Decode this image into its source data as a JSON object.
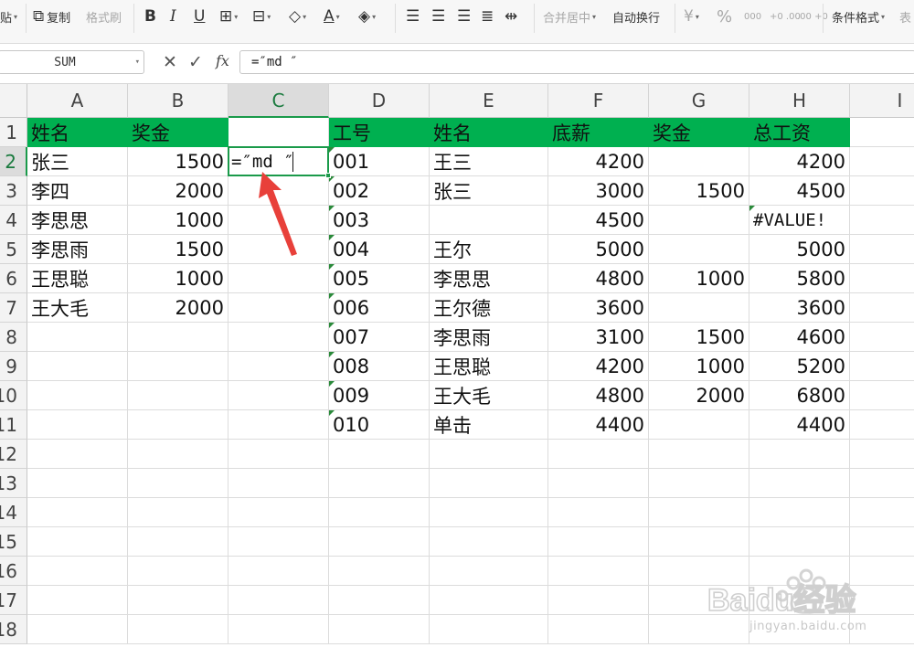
{
  "ribbon": {
    "paste_label": "贴",
    "copy_label": "复制",
    "format_painter_label": "格式刷",
    "bold_label": "B",
    "italic_label": "I",
    "underline_label": "U",
    "merge_center_label": "合并居中",
    "wrap_text_label": "自动换行",
    "percent_label": "%",
    "thousands_label": "000",
    "inc_decimal_label": "+0 .00",
    "dec_decimal_label": ".00 +0",
    "cond_format_label": "条件格式",
    "table_label": "表"
  },
  "formula_bar": {
    "name_box": "SUM",
    "fx_label": "fx",
    "formula": "=″md ″"
  },
  "columns": [
    "A",
    "B",
    "C",
    "D",
    "E",
    "F",
    "G",
    "H",
    "I"
  ],
  "rows": [
    "1",
    "2",
    "3",
    "4",
    "5",
    "6",
    "7",
    "8",
    "9",
    "10",
    "11",
    "12",
    "13",
    "14",
    "15",
    "16",
    "17",
    "18"
  ],
  "active_cell": {
    "ref": "C2",
    "text": "=″md ″"
  },
  "bonus_table": {
    "headers": [
      "姓名",
      "奖金"
    ],
    "rows": [
      [
        "张三",
        "1500"
      ],
      [
        "李四",
        "2000"
      ],
      [
        "李思思",
        "1000"
      ],
      [
        "李思雨",
        "1500"
      ],
      [
        "王思聪",
        "1000"
      ],
      [
        "王大毛",
        "2000"
      ]
    ]
  },
  "salary_table": {
    "headers": [
      "工号",
      "姓名",
      "底薪",
      "奖金",
      "总工资"
    ],
    "rows": [
      [
        "001",
        "王三",
        "4200",
        "",
        "4200"
      ],
      [
        "002",
        "张三",
        "3000",
        "1500",
        "4500"
      ],
      [
        "003",
        "",
        "4500",
        "",
        "#VALUE!"
      ],
      [
        "004",
        "王尔",
        "5000",
        "",
        "5000"
      ],
      [
        "005",
        "李思思",
        "4800",
        "1000",
        "5800"
      ],
      [
        "006",
        "王尔德",
        "3600",
        "",
        "3600"
      ],
      [
        "007",
        "李思雨",
        "3100",
        "1500",
        "4600"
      ],
      [
        "008",
        "王思聪",
        "4200",
        "1000",
        "5200"
      ],
      [
        "009",
        "王大毛",
        "4800",
        "2000",
        "6800"
      ],
      [
        "010",
        "单击",
        "4400",
        "",
        "4400"
      ]
    ]
  },
  "watermark": {
    "brand": "Baidu经验",
    "url": "jingyan.baidu.com"
  },
  "colors": {
    "header_green": "#00b050",
    "selection_green": "#1a9a4a",
    "arrow_red": "#e8403a"
  }
}
